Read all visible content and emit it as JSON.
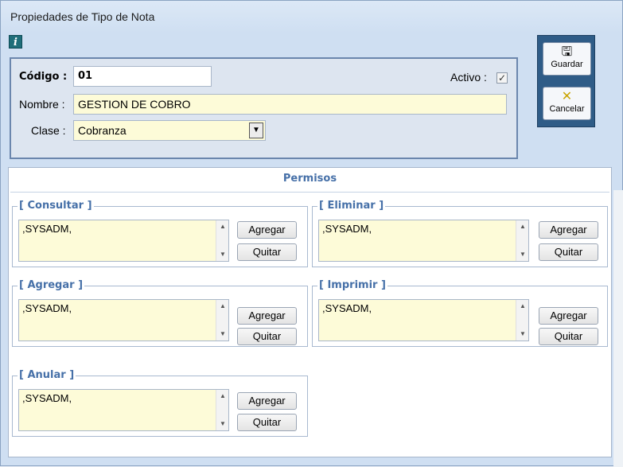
{
  "window": {
    "title": "Propiedades de Tipo de Nota"
  },
  "icons": {
    "info": "info-icon",
    "save": "floppy-disk-icon",
    "cancel": "cancel-x-icon"
  },
  "header": {
    "codigo_label": "Código :",
    "codigo_value": "01",
    "activo_label": "Activo :",
    "activo_checked": true,
    "nombre_label": "Nombre :",
    "nombre_value": "GESTION DE COBRO",
    "clase_label": "Clase :",
    "clase_value": "Cobranza"
  },
  "toolbar": {
    "save_label": "Guardar",
    "cancel_label": "Cancelar"
  },
  "permisos": {
    "title": "Permisos",
    "groups": [
      {
        "legend": "[ Consultar ]",
        "value": ",SYSADM,",
        "add_label": "Agregar",
        "remove_label": "Quitar"
      },
      {
        "legend": "[ Eliminar ]",
        "value": ",SYSADM,",
        "add_label": "Agregar",
        "remove_label": "Quitar"
      },
      {
        "legend": "[ Agregar ]",
        "value": ",SYSADM,",
        "add_label": "Agregar",
        "remove_label": "Quitar"
      },
      {
        "legend": "[ Imprimir ]",
        "value": ",SYSADM,",
        "add_label": "Agregar",
        "remove_label": "Quitar"
      },
      {
        "legend": "[ Anular ]",
        "value": ",SYSADM,",
        "add_label": "Agregar",
        "remove_label": "Quitar"
      }
    ]
  },
  "colors": {
    "accent": "#4670a8",
    "toolbar_bg": "#2f5c87",
    "field_yellow": "#fdfbd8"
  }
}
